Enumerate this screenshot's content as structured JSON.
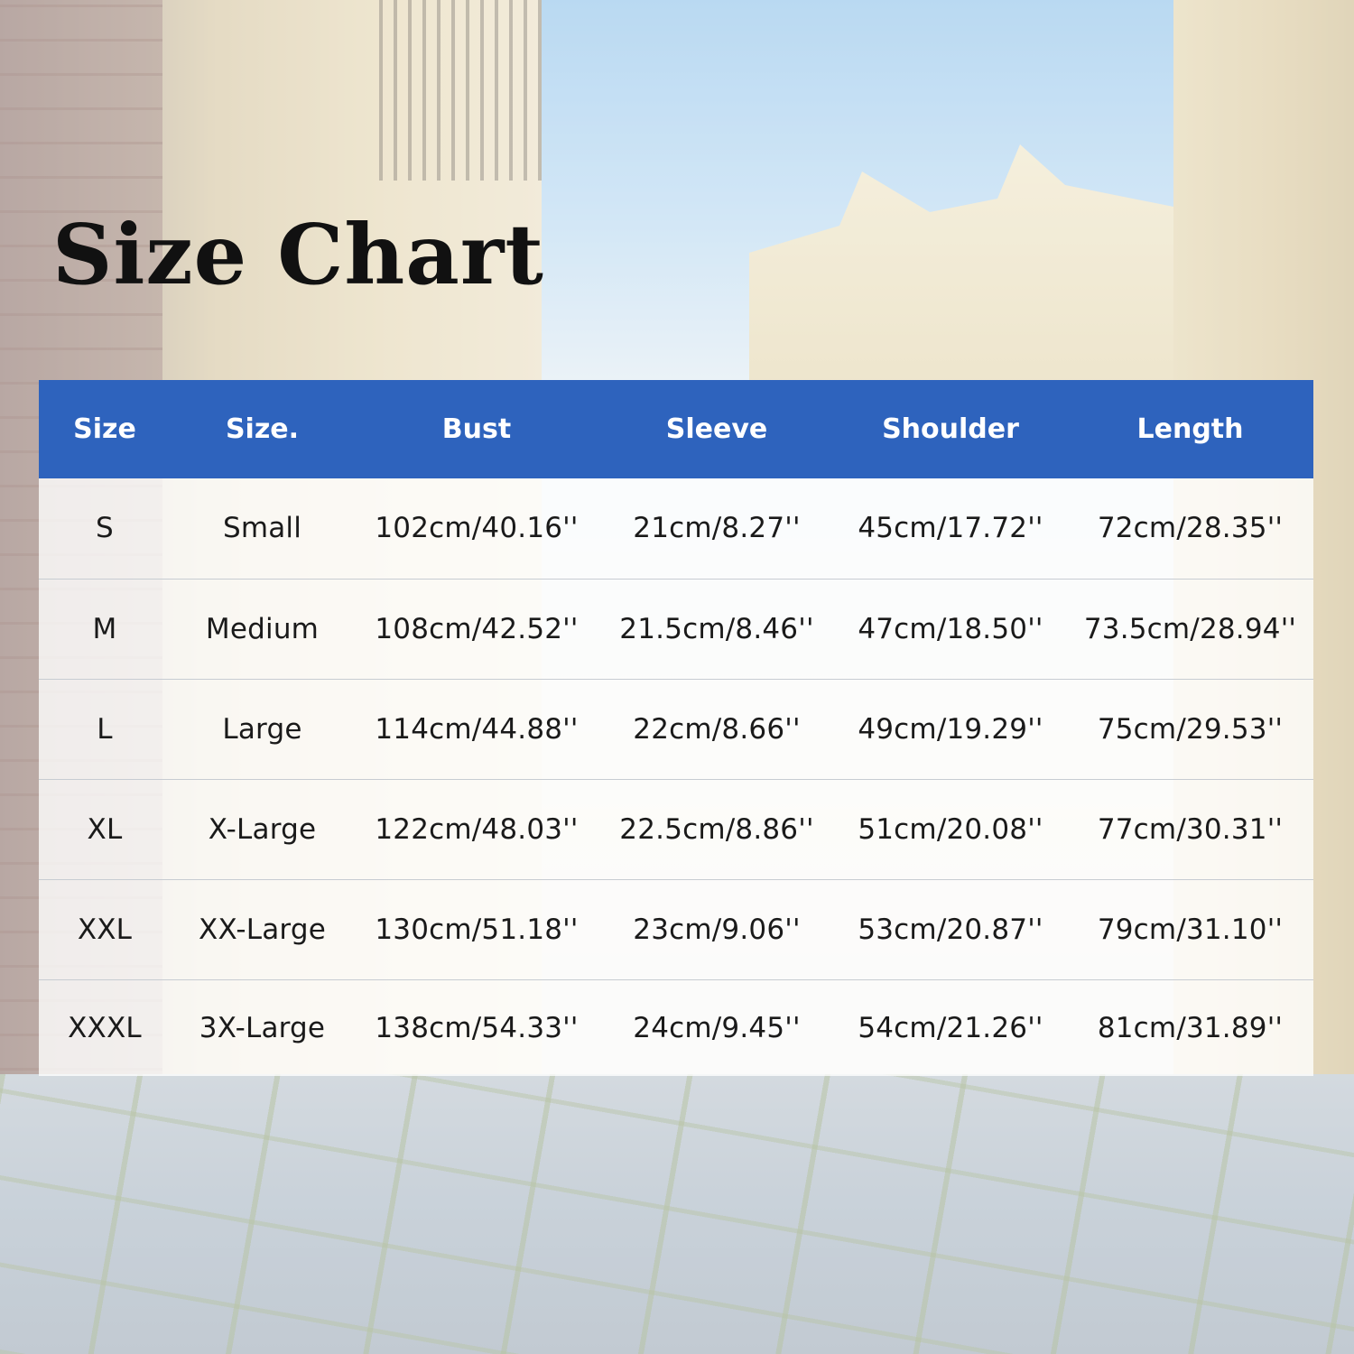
{
  "title": "Size Chart",
  "colors": {
    "header_bg": "#2e63bd",
    "header_text": "#ffffff",
    "body_text": "#1a1a1a"
  },
  "table": {
    "headers": [
      "Size",
      "Size.",
      "Bust",
      "Sleeve",
      "Shoulder",
      "Length"
    ],
    "rows": [
      [
        "S",
        "Small",
        "102cm/40.16''",
        "21cm/8.27''",
        "45cm/17.72''",
        "72cm/28.35''"
      ],
      [
        "M",
        "Medium",
        "108cm/42.52''",
        "21.5cm/8.46''",
        "47cm/18.50''",
        "73.5cm/28.94''"
      ],
      [
        "L",
        "Large",
        "114cm/44.88''",
        "22cm/8.66''",
        "49cm/19.29''",
        "75cm/29.53''"
      ],
      [
        "XL",
        "X-Large",
        "122cm/48.03''",
        "22.5cm/8.86''",
        "51cm/20.08''",
        "77cm/30.31''"
      ],
      [
        "XXL",
        "XX-Large",
        "130cm/51.18''",
        "23cm/9.06''",
        "53cm/20.87''",
        "79cm/31.10''"
      ],
      [
        "XXXL",
        "3X-Large",
        "138cm/54.33''",
        "24cm/9.45''",
        "54cm/21.26''",
        "81cm/31.89''"
      ]
    ]
  }
}
